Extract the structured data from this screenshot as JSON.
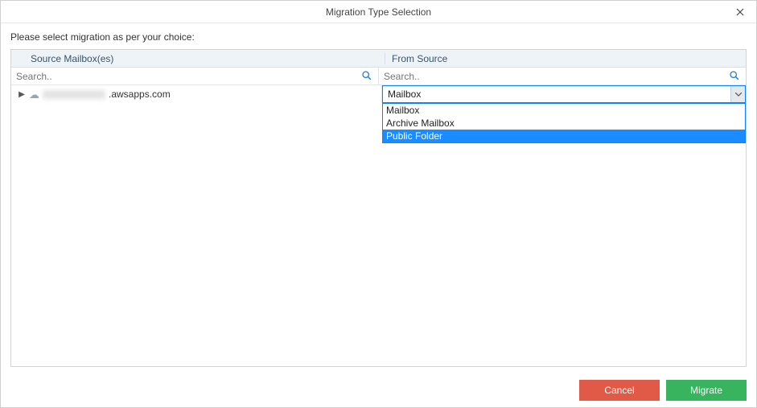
{
  "titlebar": {
    "title": "Migration Type Selection"
  },
  "instruction": "Please select migration as per your choice:",
  "columns": {
    "source_mailboxes": "Source Mailbox(es)",
    "from_source": "From Source"
  },
  "search": {
    "left_placeholder": "Search..",
    "right_placeholder": "Search.."
  },
  "tree": {
    "item0_suffix": ".awsapps.com"
  },
  "combo": {
    "selected": "Mailbox",
    "options": [
      "Mailbox",
      "Archive Mailbox",
      "Public Folder"
    ],
    "highlighted_index": 2
  },
  "footer": {
    "cancel": "Cancel",
    "migrate": "Migrate"
  }
}
